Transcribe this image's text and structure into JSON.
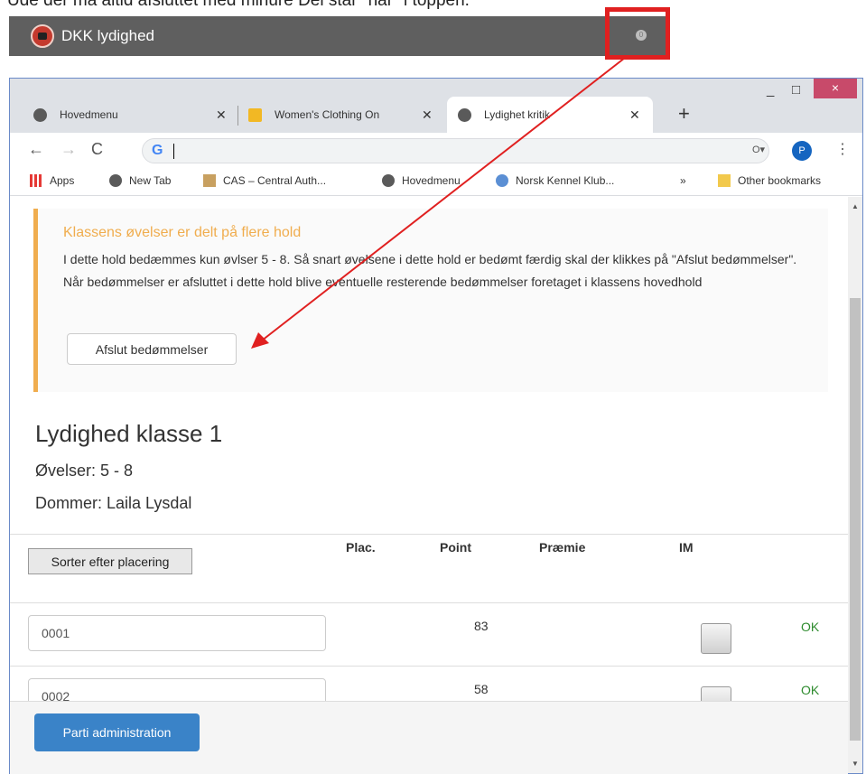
{
  "caption": "Ude der ma altid afsluttet med minure Del star \"nar\" i toppen.",
  "appbar": {
    "title": "DKK lydighed",
    "badge": "0"
  },
  "browser": {
    "tabs": [
      {
        "label": "Hovedmenu"
      },
      {
        "label": "Women's Clothing On"
      },
      {
        "label": "Lydighet kritik"
      }
    ],
    "new_tab": "+",
    "window_controls": {
      "minimize": "_",
      "maximize": "□",
      "close": "×"
    },
    "avatar_letter": "P",
    "bookmarks": [
      "Apps",
      "New Tab",
      "CAS – Central Auth...",
      "Hovedmenu",
      "Norsk Kennel Klub...",
      "»",
      "Other bookmarks"
    ]
  },
  "alert": {
    "title": "Klassens øvelser er delt på flere hold",
    "body": "I dette hold bedæmmes kun øvlser 5 - 8. Så snart øvelsene i dette hold er bedømt færdig skal der klikkes på \"Afslut bedømmelser\". Når bedømmelser er afsluttet i dette hold blive eventuelle resterende bedømmelser foretaget i klassens hovedhold",
    "button": "Afslut bedømmelser"
  },
  "klasse": {
    "title": "Lydighed klasse 1",
    "ovelser": "Øvelser: 5 - 8",
    "dommer": "Dommer: Laila Lysdal"
  },
  "table": {
    "sort_button": "Sorter efter placering",
    "headers": {
      "plac": "Plac.",
      "point": "Point",
      "praemie": "Præmie",
      "im": "IM"
    },
    "rows": [
      {
        "id": "0001",
        "point": "83",
        "status": "OK"
      },
      {
        "id": "0002",
        "point": "58",
        "status": "OK"
      }
    ]
  },
  "footer": {
    "button": "Parti administration"
  },
  "colors": {
    "accent_orange": "#f0ad4e",
    "primary_blue": "#3a83c8",
    "ok_green": "#2e8b2e",
    "annotation_red": "#e02020"
  }
}
